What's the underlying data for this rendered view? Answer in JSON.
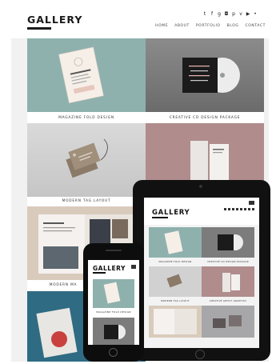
{
  "site": {
    "logo": "GALLERY"
  },
  "social_icons": [
    "twitter-icon",
    "facebook-icon",
    "google-plus-icon",
    "instagram-icon",
    "pinterest-icon",
    "vimeo-icon",
    "youtube-icon",
    "flickr-icon"
  ],
  "social_glyphs": [
    "t",
    "f",
    "g",
    "◘",
    "p",
    "v",
    "▶",
    "•"
  ],
  "nav": [
    "HOME",
    "ABOUT",
    "PORTFOLIO",
    "BLOG",
    "CONTACT"
  ],
  "portfolio": [
    {
      "caption": "MAGAZINE FOLD DESIGN"
    },
    {
      "caption": "CREATIVE CD DESIGN PACKAGE"
    },
    {
      "caption": "MODERN TAG LAYOUT"
    },
    {
      "caption": ""
    },
    {
      "caption": "MODERN MA"
    },
    {
      "caption": ""
    }
  ],
  "tablet": {
    "logo": "GALLERY",
    "captions": [
      "MAGAZINE FOLD DESIGN",
      "CREATIVE CD DESIGN PACKAGE",
      "MODERN TAG LAYOUT",
      "CREATIVE ARTIST GRAPHICS"
    ]
  },
  "phone": {
    "logo": "GALLERY",
    "captions": [
      "MAGAZINE FOLD DESIGN"
    ]
  },
  "colors": {
    "background": "#f1f1f1",
    "ink": "#1a1a1a",
    "device": "#111111"
  }
}
